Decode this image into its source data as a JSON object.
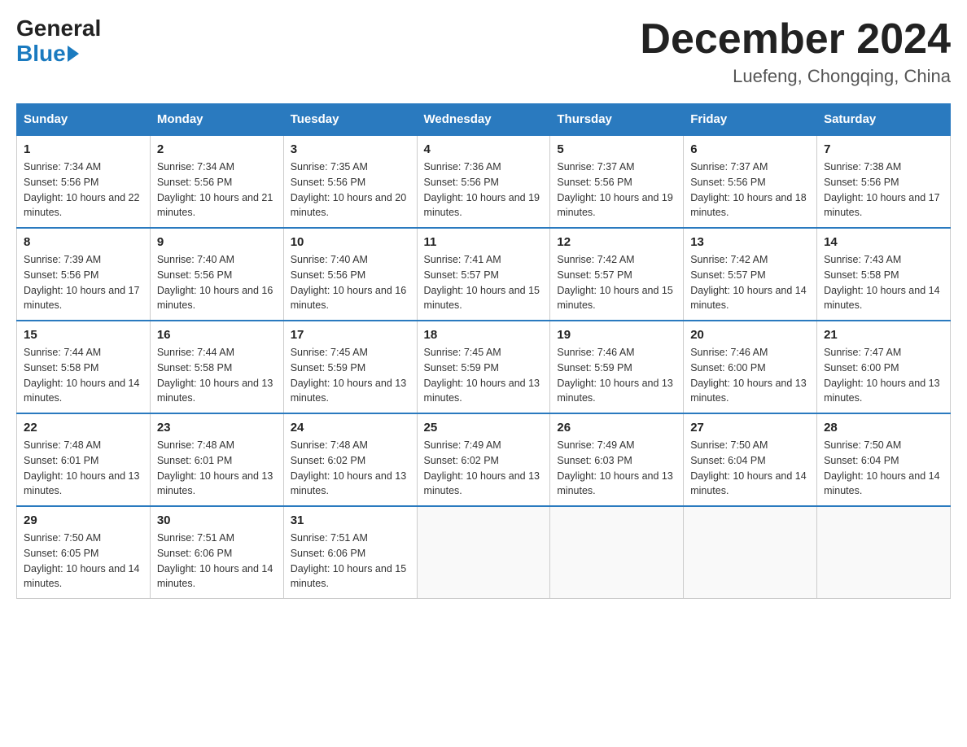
{
  "header": {
    "logo_general": "General",
    "logo_blue": "Blue",
    "main_title": "December 2024",
    "subtitle": "Luefeng, Chongqing, China"
  },
  "weekdays": [
    "Sunday",
    "Monday",
    "Tuesday",
    "Wednesday",
    "Thursday",
    "Friday",
    "Saturday"
  ],
  "weeks": [
    [
      {
        "day": "1",
        "sunrise": "7:34 AM",
        "sunset": "5:56 PM",
        "daylight": "10 hours and 22 minutes."
      },
      {
        "day": "2",
        "sunrise": "7:34 AM",
        "sunset": "5:56 PM",
        "daylight": "10 hours and 21 minutes."
      },
      {
        "day": "3",
        "sunrise": "7:35 AM",
        "sunset": "5:56 PM",
        "daylight": "10 hours and 20 minutes."
      },
      {
        "day": "4",
        "sunrise": "7:36 AM",
        "sunset": "5:56 PM",
        "daylight": "10 hours and 19 minutes."
      },
      {
        "day": "5",
        "sunrise": "7:37 AM",
        "sunset": "5:56 PM",
        "daylight": "10 hours and 19 minutes."
      },
      {
        "day": "6",
        "sunrise": "7:37 AM",
        "sunset": "5:56 PM",
        "daylight": "10 hours and 18 minutes."
      },
      {
        "day": "7",
        "sunrise": "7:38 AM",
        "sunset": "5:56 PM",
        "daylight": "10 hours and 17 minutes."
      }
    ],
    [
      {
        "day": "8",
        "sunrise": "7:39 AM",
        "sunset": "5:56 PM",
        "daylight": "10 hours and 17 minutes."
      },
      {
        "day": "9",
        "sunrise": "7:40 AM",
        "sunset": "5:56 PM",
        "daylight": "10 hours and 16 minutes."
      },
      {
        "day": "10",
        "sunrise": "7:40 AM",
        "sunset": "5:56 PM",
        "daylight": "10 hours and 16 minutes."
      },
      {
        "day": "11",
        "sunrise": "7:41 AM",
        "sunset": "5:57 PM",
        "daylight": "10 hours and 15 minutes."
      },
      {
        "day": "12",
        "sunrise": "7:42 AM",
        "sunset": "5:57 PM",
        "daylight": "10 hours and 15 minutes."
      },
      {
        "day": "13",
        "sunrise": "7:42 AM",
        "sunset": "5:57 PM",
        "daylight": "10 hours and 14 minutes."
      },
      {
        "day": "14",
        "sunrise": "7:43 AM",
        "sunset": "5:58 PM",
        "daylight": "10 hours and 14 minutes."
      }
    ],
    [
      {
        "day": "15",
        "sunrise": "7:44 AM",
        "sunset": "5:58 PM",
        "daylight": "10 hours and 14 minutes."
      },
      {
        "day": "16",
        "sunrise": "7:44 AM",
        "sunset": "5:58 PM",
        "daylight": "10 hours and 13 minutes."
      },
      {
        "day": "17",
        "sunrise": "7:45 AM",
        "sunset": "5:59 PM",
        "daylight": "10 hours and 13 minutes."
      },
      {
        "day": "18",
        "sunrise": "7:45 AM",
        "sunset": "5:59 PM",
        "daylight": "10 hours and 13 minutes."
      },
      {
        "day": "19",
        "sunrise": "7:46 AM",
        "sunset": "5:59 PM",
        "daylight": "10 hours and 13 minutes."
      },
      {
        "day": "20",
        "sunrise": "7:46 AM",
        "sunset": "6:00 PM",
        "daylight": "10 hours and 13 minutes."
      },
      {
        "day": "21",
        "sunrise": "7:47 AM",
        "sunset": "6:00 PM",
        "daylight": "10 hours and 13 minutes."
      }
    ],
    [
      {
        "day": "22",
        "sunrise": "7:48 AM",
        "sunset": "6:01 PM",
        "daylight": "10 hours and 13 minutes."
      },
      {
        "day": "23",
        "sunrise": "7:48 AM",
        "sunset": "6:01 PM",
        "daylight": "10 hours and 13 minutes."
      },
      {
        "day": "24",
        "sunrise": "7:48 AM",
        "sunset": "6:02 PM",
        "daylight": "10 hours and 13 minutes."
      },
      {
        "day": "25",
        "sunrise": "7:49 AM",
        "sunset": "6:02 PM",
        "daylight": "10 hours and 13 minutes."
      },
      {
        "day": "26",
        "sunrise": "7:49 AM",
        "sunset": "6:03 PM",
        "daylight": "10 hours and 13 minutes."
      },
      {
        "day": "27",
        "sunrise": "7:50 AM",
        "sunset": "6:04 PM",
        "daylight": "10 hours and 14 minutes."
      },
      {
        "day": "28",
        "sunrise": "7:50 AM",
        "sunset": "6:04 PM",
        "daylight": "10 hours and 14 minutes."
      }
    ],
    [
      {
        "day": "29",
        "sunrise": "7:50 AM",
        "sunset": "6:05 PM",
        "daylight": "10 hours and 14 minutes."
      },
      {
        "day": "30",
        "sunrise": "7:51 AM",
        "sunset": "6:06 PM",
        "daylight": "10 hours and 14 minutes."
      },
      {
        "day": "31",
        "sunrise": "7:51 AM",
        "sunset": "6:06 PM",
        "daylight": "10 hours and 15 minutes."
      },
      null,
      null,
      null,
      null
    ]
  ]
}
